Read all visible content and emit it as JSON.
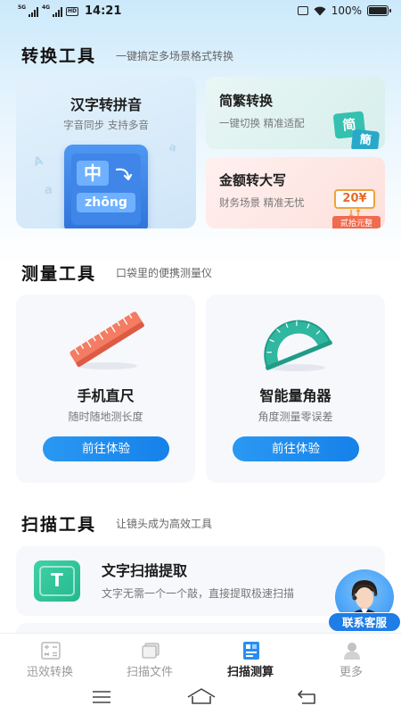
{
  "status_bar": {
    "network_1": "5G",
    "network_2": "4G",
    "hd": "HD",
    "time": "14:21",
    "battery": "100%"
  },
  "conversion": {
    "title": "转换工具",
    "subtitle": "一键搞定多场景格式转换",
    "pinyin_card": {
      "title": "汉字转拼音",
      "desc": "字音同步  支持多音",
      "illus_char": "中",
      "illus_pinyin": "zhōng"
    },
    "jianfan_card": {
      "title": "简繁转换",
      "desc": "一键切换  精准适配",
      "illus_simple": "简",
      "illus_trad": "簡"
    },
    "money_card": {
      "title": "金额转大写",
      "desc": "财务场景  精准无忧",
      "illus_amount": "20¥",
      "illus_upper": "贰拾元整"
    }
  },
  "measure": {
    "title": "测量工具",
    "subtitle": "口袋里的便携测量仪",
    "ruler": {
      "name": "手机直尺",
      "desc": "随时随地测长度",
      "button": "前往体验"
    },
    "protractor": {
      "name": "智能量角器",
      "desc": "角度测量零误差",
      "button": "前往体验"
    }
  },
  "scan": {
    "title": "扫描工具",
    "subtitle": "让镜头成为高效工具",
    "ocr": {
      "icon_letter": "T",
      "title": "文字扫描提取",
      "desc": "文字无需一个一个敲，直接提取极速扫描"
    }
  },
  "customer_service": {
    "label": "联系客服"
  },
  "tabs": [
    {
      "label": "迅效转换",
      "active": false
    },
    {
      "label": "扫描文件",
      "active": false
    },
    {
      "label": "扫描测算",
      "active": true
    },
    {
      "label": "更多",
      "active": false
    }
  ],
  "colors": {
    "accent": "#1a88ee",
    "teal": "#2bc3a0",
    "ruler_red": "#f2705e",
    "tab_active": "#222222",
    "tab_inactive": "#9a9a9a"
  }
}
